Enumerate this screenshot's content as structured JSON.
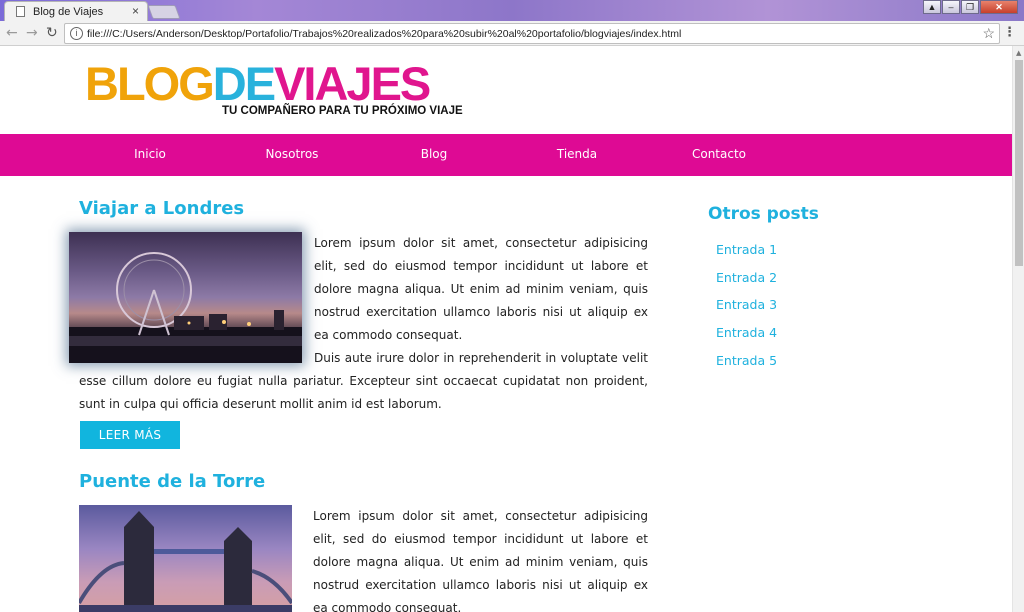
{
  "browser": {
    "tab_title": "Blog de Viajes",
    "tab_close": "×",
    "url": "file:///C:/Users/Anderson/Desktop/Portafolio/Trabajos%20realizados%20para%20subir%20al%20portafolio/blogviajes/index.html",
    "window_buttons": {
      "user": "▲",
      "minimize": "–",
      "restore": "❐",
      "close": "✕"
    }
  },
  "header": {
    "logo_part1": "BLOG",
    "logo_part2": "DE",
    "logo_part3": "VIAJES",
    "tagline": "TU COMPAÑERO PARA TU PRÓXIMO VIAJE",
    "colors": {
      "orange": "#f0a30a",
      "blue": "#29b2dc",
      "pink": "#e0168e"
    }
  },
  "nav": {
    "background": "#de0a94",
    "items": [
      {
        "label": "Inicio"
      },
      {
        "label": "Nosotros"
      },
      {
        "label": "Blog"
      },
      {
        "label": "Tienda"
      },
      {
        "label": "Contacto"
      }
    ]
  },
  "posts": [
    {
      "title": "Viajar a Londres",
      "image": "london-eye-photo",
      "paragraph1": "Lorem ipsum dolor sit amet, consectetur adipisicing elit, sed do eiusmod tempor incididunt ut labore et dolore magna aliqua. Ut enim ad minim veniam, quis nostrud exercitation ullamco laboris nisi ut aliquip ex ea commodo consequat.",
      "paragraph2": "Duis aute irure dolor in reprehenderit in voluptate velit esse cillum dolore eu fugiat nulla pariatur. Excepteur sint occaecat cupidatat non proident, sunt in culpa qui officia deserunt mollit anim id est laborum.",
      "button": "LEER MÁS"
    },
    {
      "title": "Puente de la Torre",
      "image": "tower-bridge-photo",
      "paragraph1": "Lorem ipsum dolor sit amet, consectetur adipisicing elit, sed do eiusmod tempor incididunt ut labore et dolore magna aliqua. Ut enim ad minim veniam, quis nostrud exercitation ullamco laboris nisi ut aliquip ex ea commodo consequat."
    }
  ],
  "sidebar": {
    "title": "Otros posts",
    "entries": [
      {
        "label": "Entrada 1"
      },
      {
        "label": "Entrada 2"
      },
      {
        "label": "Entrada 3"
      },
      {
        "label": "Entrada 4"
      },
      {
        "label": "Entrada 5"
      }
    ]
  },
  "accent_color": "#1fb1de"
}
